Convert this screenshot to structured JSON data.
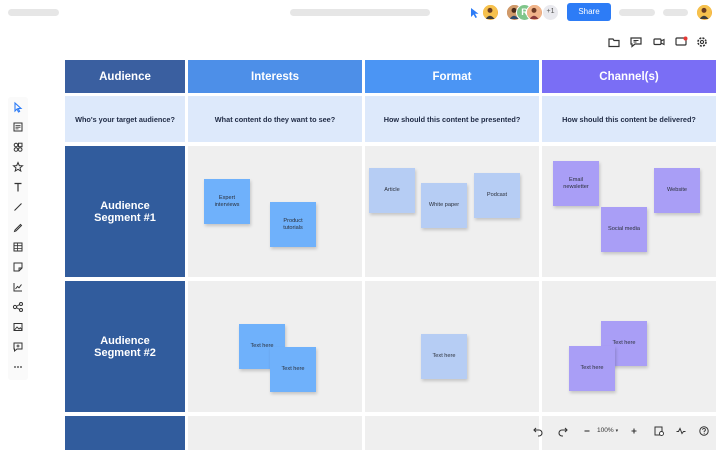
{
  "topbar": {
    "share_label": "Share",
    "collab_more": "+1",
    "avatar_r_initial": "R"
  },
  "board": {
    "headers": [
      "Audience",
      "Interests",
      "Format",
      "Channel(s)"
    ],
    "questions": [
      "Who's your target audience?",
      "What content do they want to see?",
      "How should this content be presented?",
      "How should this content be delivered?"
    ],
    "segments": [
      "Audience Segment #1",
      "Audience Segment #2"
    ],
    "stickies": {
      "interests_1": [
        "Expert interviews",
        "Product tutorials"
      ],
      "format_1": [
        "Article",
        "White paper",
        "Podcast"
      ],
      "channels_1": [
        "Email newsletter",
        "Social media",
        "Website"
      ],
      "interests_2": [
        "Text here",
        "Text here"
      ],
      "format_2": [
        "Text here"
      ],
      "channels_2": [
        "Text here",
        "Text here"
      ]
    }
  },
  "controls": {
    "zoom_level": "100%"
  },
  "colors": {
    "audience_header": "#3a5fa0",
    "interests_header": "#4d8fe8",
    "format_header": "#4b95f4",
    "channels_header": "#7a6ef5",
    "segment_cell": "#315c9d",
    "sticky_blue": "#6fb1fb",
    "sticky_pale": "#b6cdf4",
    "sticky_purple": "#a99ef6",
    "share_button": "#2d7cf6"
  }
}
